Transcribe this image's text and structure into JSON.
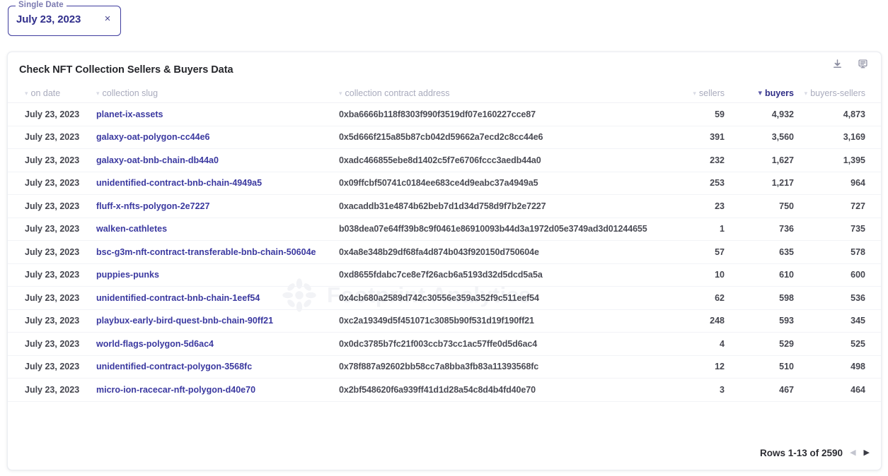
{
  "datepicker": {
    "legend": "Single Date",
    "value": "July 23, 2023",
    "clear_icon": "close-icon",
    "clear_glyph": "×"
  },
  "card": {
    "title": "Check NFT Collection Sellers & Buyers Data",
    "actions": [
      {
        "name": "download-icon",
        "label": "Download"
      },
      {
        "name": "api-icon",
        "label": "API"
      }
    ]
  },
  "watermark": {
    "text": "Footprint Analytics",
    "logo": "sunburst-logo"
  },
  "table": {
    "columns": [
      {
        "key": "on_date",
        "label": "on date",
        "align": "left",
        "active": false
      },
      {
        "key": "slug",
        "label": "collection slug",
        "align": "left",
        "active": false
      },
      {
        "key": "address",
        "label": "collection contract address",
        "align": "left",
        "active": false
      },
      {
        "key": "sellers",
        "label": "sellers",
        "align": "right",
        "active": false
      },
      {
        "key": "buyers",
        "label": "buyers",
        "align": "right",
        "active": true
      },
      {
        "key": "diff",
        "label": "buyers-sellers",
        "align": "right",
        "active": false
      }
    ],
    "rows": [
      {
        "on_date": "July 23, 2023",
        "slug": "planet-ix-assets",
        "address": "0xba6666b118f8303f990f3519df07e160227cce87",
        "sellers": "59",
        "buyers": "4,932",
        "diff": "4,873"
      },
      {
        "on_date": "July 23, 2023",
        "slug": "galaxy-oat-polygon-cc44e6",
        "address": "0x5d666f215a85b87cb042d59662a7ecd2c8cc44e6",
        "sellers": "391",
        "buyers": "3,560",
        "diff": "3,169"
      },
      {
        "on_date": "July 23, 2023",
        "slug": "galaxy-oat-bnb-chain-db44a0",
        "address": "0xadc466855ebe8d1402c5f7e6706fccc3aedb44a0",
        "sellers": "232",
        "buyers": "1,627",
        "diff": "1,395"
      },
      {
        "on_date": "July 23, 2023",
        "slug": "unidentified-contract-bnb-chain-4949a5",
        "address": "0x09ffcbf50741c0184ee683ce4d9eabc37a4949a5",
        "sellers": "253",
        "buyers": "1,217",
        "diff": "964"
      },
      {
        "on_date": "July 23, 2023",
        "slug": "fluff-x-nfts-polygon-2e7227",
        "address": "0xacaddb31e4874b62beb7d1d34d758d9f7b2e7227",
        "sellers": "23",
        "buyers": "750",
        "diff": "727"
      },
      {
        "on_date": "July 23, 2023",
        "slug": "walken-cathletes",
        "address": "b038dea07e64ff39b8c9f0461e86910093b44d3a1972d05e3749ad3d01244655",
        "sellers": "1",
        "buyers": "736",
        "diff": "735"
      },
      {
        "on_date": "July 23, 2023",
        "slug": "bsc-g3m-nft-contract-transferable-bnb-chain-50604e",
        "address": "0x4a8e348b29df68fa4d874b043f920150d750604e",
        "sellers": "57",
        "buyers": "635",
        "diff": "578"
      },
      {
        "on_date": "July 23, 2023",
        "slug": "puppies-punks",
        "address": "0xd8655fdabc7ce8e7f26acb6a5193d32d5dcd5a5a",
        "sellers": "10",
        "buyers": "610",
        "diff": "600"
      },
      {
        "on_date": "July 23, 2023",
        "slug": "unidentified-contract-bnb-chain-1eef54",
        "address": "0x4cb680a2589d742c30556e359a352f9c511eef54",
        "sellers": "62",
        "buyers": "598",
        "diff": "536"
      },
      {
        "on_date": "July 23, 2023",
        "slug": "playbux-early-bird-quest-bnb-chain-90ff21",
        "address": "0xc2a19349d5f451071c3085b90f531d19f190ff21",
        "sellers": "248",
        "buyers": "593",
        "diff": "345"
      },
      {
        "on_date": "July 23, 2023",
        "slug": "world-flags-polygon-5d6ac4",
        "address": "0x0dc3785b7fc21f003ccb73cc1ac57ffe0d5d6ac4",
        "sellers": "4",
        "buyers": "529",
        "diff": "525"
      },
      {
        "on_date": "July 23, 2023",
        "slug": "unidentified-contract-polygon-3568fc",
        "address": "0x78f887a92602bb58cc7a8bba3fb83a11393568fc",
        "sellers": "12",
        "buyers": "510",
        "diff": "498"
      },
      {
        "on_date": "July 23, 2023",
        "slug": "micro-ion-racecar-nft-polygon-d40e70",
        "address": "0x2bf548620f6a939ff41d1d28a54c8d4b4fd40e70",
        "sellers": "3",
        "buyers": "467",
        "diff": "464"
      }
    ]
  },
  "footer": {
    "rows_label": "Rows 1-13 of 2590",
    "prev_glyph": "◀",
    "next_glyph": "▶"
  },
  "colors": {
    "accent": "#3b39a0",
    "accent_dark": "#2f2d86",
    "text": "#45464f",
    "muted": "#a9abbd",
    "border": "#f2f3f7"
  }
}
